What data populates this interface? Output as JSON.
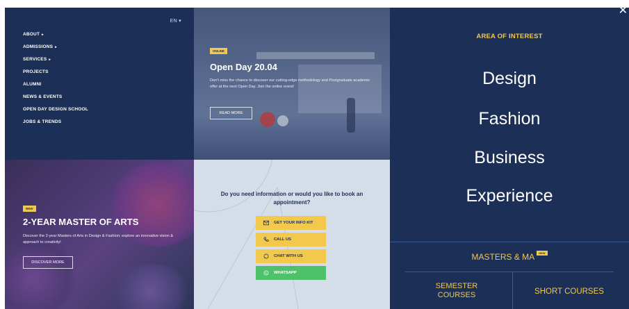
{
  "nav": {
    "lang": "EN",
    "items": [
      {
        "label": "ABOUT",
        "caret": "▸"
      },
      {
        "label": "ADMISSIONS",
        "caret": "▸"
      },
      {
        "label": "SERVICES",
        "caret": "▸"
      },
      {
        "label": "PROJECTS",
        "caret": ""
      },
      {
        "label": "ALUMNI",
        "caret": ""
      },
      {
        "label": "NEWS & EVENTS",
        "caret": ""
      },
      {
        "label": "OPEN DAY DESIGN SCHOOL",
        "caret": ""
      },
      {
        "label": "JOBS & TRENDS",
        "caret": ""
      }
    ]
  },
  "open_day": {
    "badge": "ONLINE",
    "title": "Open Day 20.04",
    "text": "Don't miss the chance to discover our cutting-edge methodology and Postgraduate academic offer at the next Open Day. Join the online event!",
    "button": "READ MORE"
  },
  "master": {
    "badge": "NEW",
    "title": "2-YEAR MASTER OF ARTS",
    "text": "Discover the 2-year Masters of Arts in Design & Fashion: explore an innovative vision & approach to creativity!",
    "button": "DISCOVER MORE"
  },
  "contact": {
    "question": "Do you need information or would you like to book an appointment?",
    "buttons": [
      {
        "label": "GET YOUR INFO KIT",
        "icon": "mail-icon"
      },
      {
        "label": "CALL US",
        "icon": "phone-icon"
      },
      {
        "label": "CHAT WITH US",
        "icon": "chat-icon"
      },
      {
        "label": "WHATSAPP",
        "icon": "whatsapp-icon"
      }
    ]
  },
  "right": {
    "close": "✕",
    "area_title": "AREA OF INTEREST",
    "areas": [
      "Design",
      "Fashion",
      "Business",
      "Experience"
    ],
    "masters_label": "MASTERS & MA",
    "masters_badge": "NEW",
    "semester_label": "SEMESTER COURSES",
    "short_label": "SHORT COURSES"
  },
  "colors": {
    "navy": "#1c2f57",
    "accent_yellow": "#f2c94c",
    "whatsapp_green": "#4fc16b",
    "light_panel": "#d5dde8"
  }
}
